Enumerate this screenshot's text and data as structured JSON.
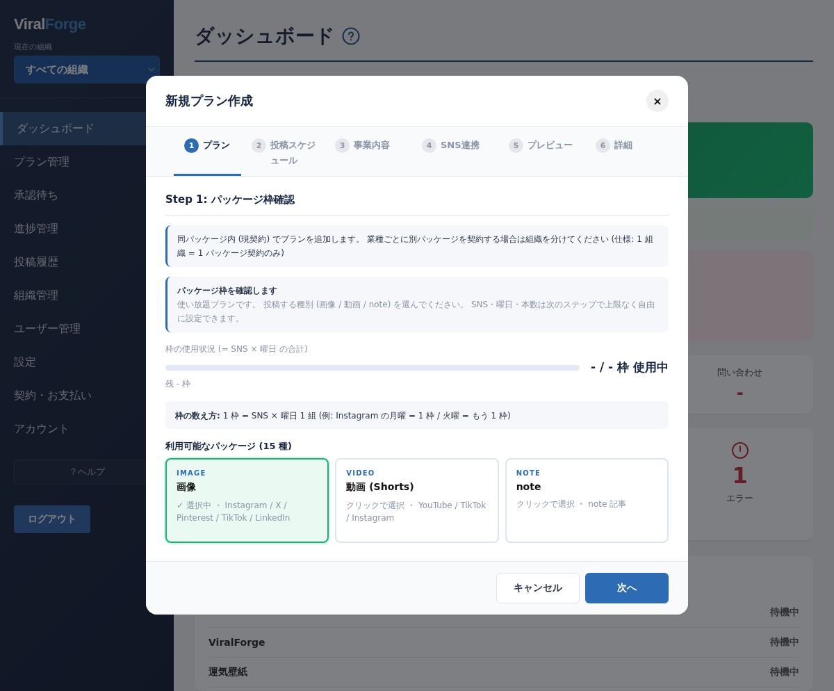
{
  "sidebar": {
    "logo": {
      "first": "Viral",
      "second": "Forge"
    },
    "org_label": "現在の組織",
    "org_select": {
      "value": "すべての組織"
    },
    "items": [
      {
        "label": "ダッシュボード",
        "selected": true
      },
      {
        "label": "プラン管理",
        "selected": false
      },
      {
        "label": "承認待ち",
        "selected": false
      },
      {
        "label": "進捗管理",
        "selected": false
      },
      {
        "label": "投稿履歴",
        "selected": false
      },
      {
        "label": "組織管理",
        "selected": false
      },
      {
        "label": "ユーザー管理",
        "selected": false
      },
      {
        "label": "設定",
        "selected": false
      },
      {
        "label": "契約・お支払い",
        "selected": false
      },
      {
        "label": "アカウント",
        "selected": false
      }
    ],
    "help_button": "？ヘルプ",
    "logout_button": "ログアウト"
  },
  "page": {
    "title": "ダッシュボード",
    "stat_card": {
      "label": "問い合わせ",
      "value": "-"
    },
    "error_card": {
      "value": "1",
      "label": "エラー"
    },
    "queue_rows": [
      {
        "status": "待機中"
      },
      {
        "name": "ViralForge",
        "status": "待機中"
      },
      {
        "name": "運気壁紙",
        "status": "待機中"
      }
    ]
  },
  "modal": {
    "title": "新規プラン作成",
    "close": "×",
    "steps": [
      {
        "number": "1",
        "label": "プラン",
        "selected": true
      },
      {
        "number": "2",
        "label": "投稿スケジュール",
        "selected": false
      },
      {
        "number": "3",
        "label": "事業内容",
        "selected": false
      },
      {
        "number": "4",
        "label": "SNS連携",
        "selected": false
      },
      {
        "number": "5",
        "label": "プレビュー",
        "selected": false
      },
      {
        "number": "6",
        "label": "詳細",
        "selected": false
      }
    ],
    "heading": "Step 1: パッケージ枠確認",
    "notice": "同パッケージ内 (現契約) でプランを追加します。 業種ごとに別パッケージを契約する場合は組織を分けてください (仕様: 1 組織 = 1 パッケージ契約のみ)",
    "info": {
      "title": "パッケージ枠を確認します",
      "body": "使い放題プランです。 投稿する種別 (画像 / 動画 / note) を選んでください。 SNS・曜日・本数は次のステップで上限なく自由に設定できます。"
    },
    "usage": {
      "label": "枠の使用状況 (= SNS × 曜日 の合計)",
      "level": 0,
      "reading": "- / - 枠 使用中",
      "remaining": "残 - 枠"
    },
    "rule": "**枠の数え方:** 1 枠 = SNS × 曜日 1 組 (例: Instagram の月曜 = 1 枠 / 火曜 = もう 1 枠)",
    "packages_title": "利用可能なパッケージ (15 種)",
    "packages": [
      {
        "tag": "IMAGE",
        "name": "画像",
        "desc": "✓ 選択中 ・ Instagram / X / Pinterest / TikTok / LinkedIn",
        "selected": true
      },
      {
        "tag": "VIDEO",
        "name": "動画 (Shorts)",
        "desc": "クリックで選択 ・ YouTube / TikTok / Instagram",
        "selected": false
      },
      {
        "tag": "NOTE",
        "name": "note",
        "desc": "クリックで選択 ・ note 記事",
        "selected": false
      }
    ],
    "cancel_button": "キャンセル",
    "next_button": "次へ"
  }
}
